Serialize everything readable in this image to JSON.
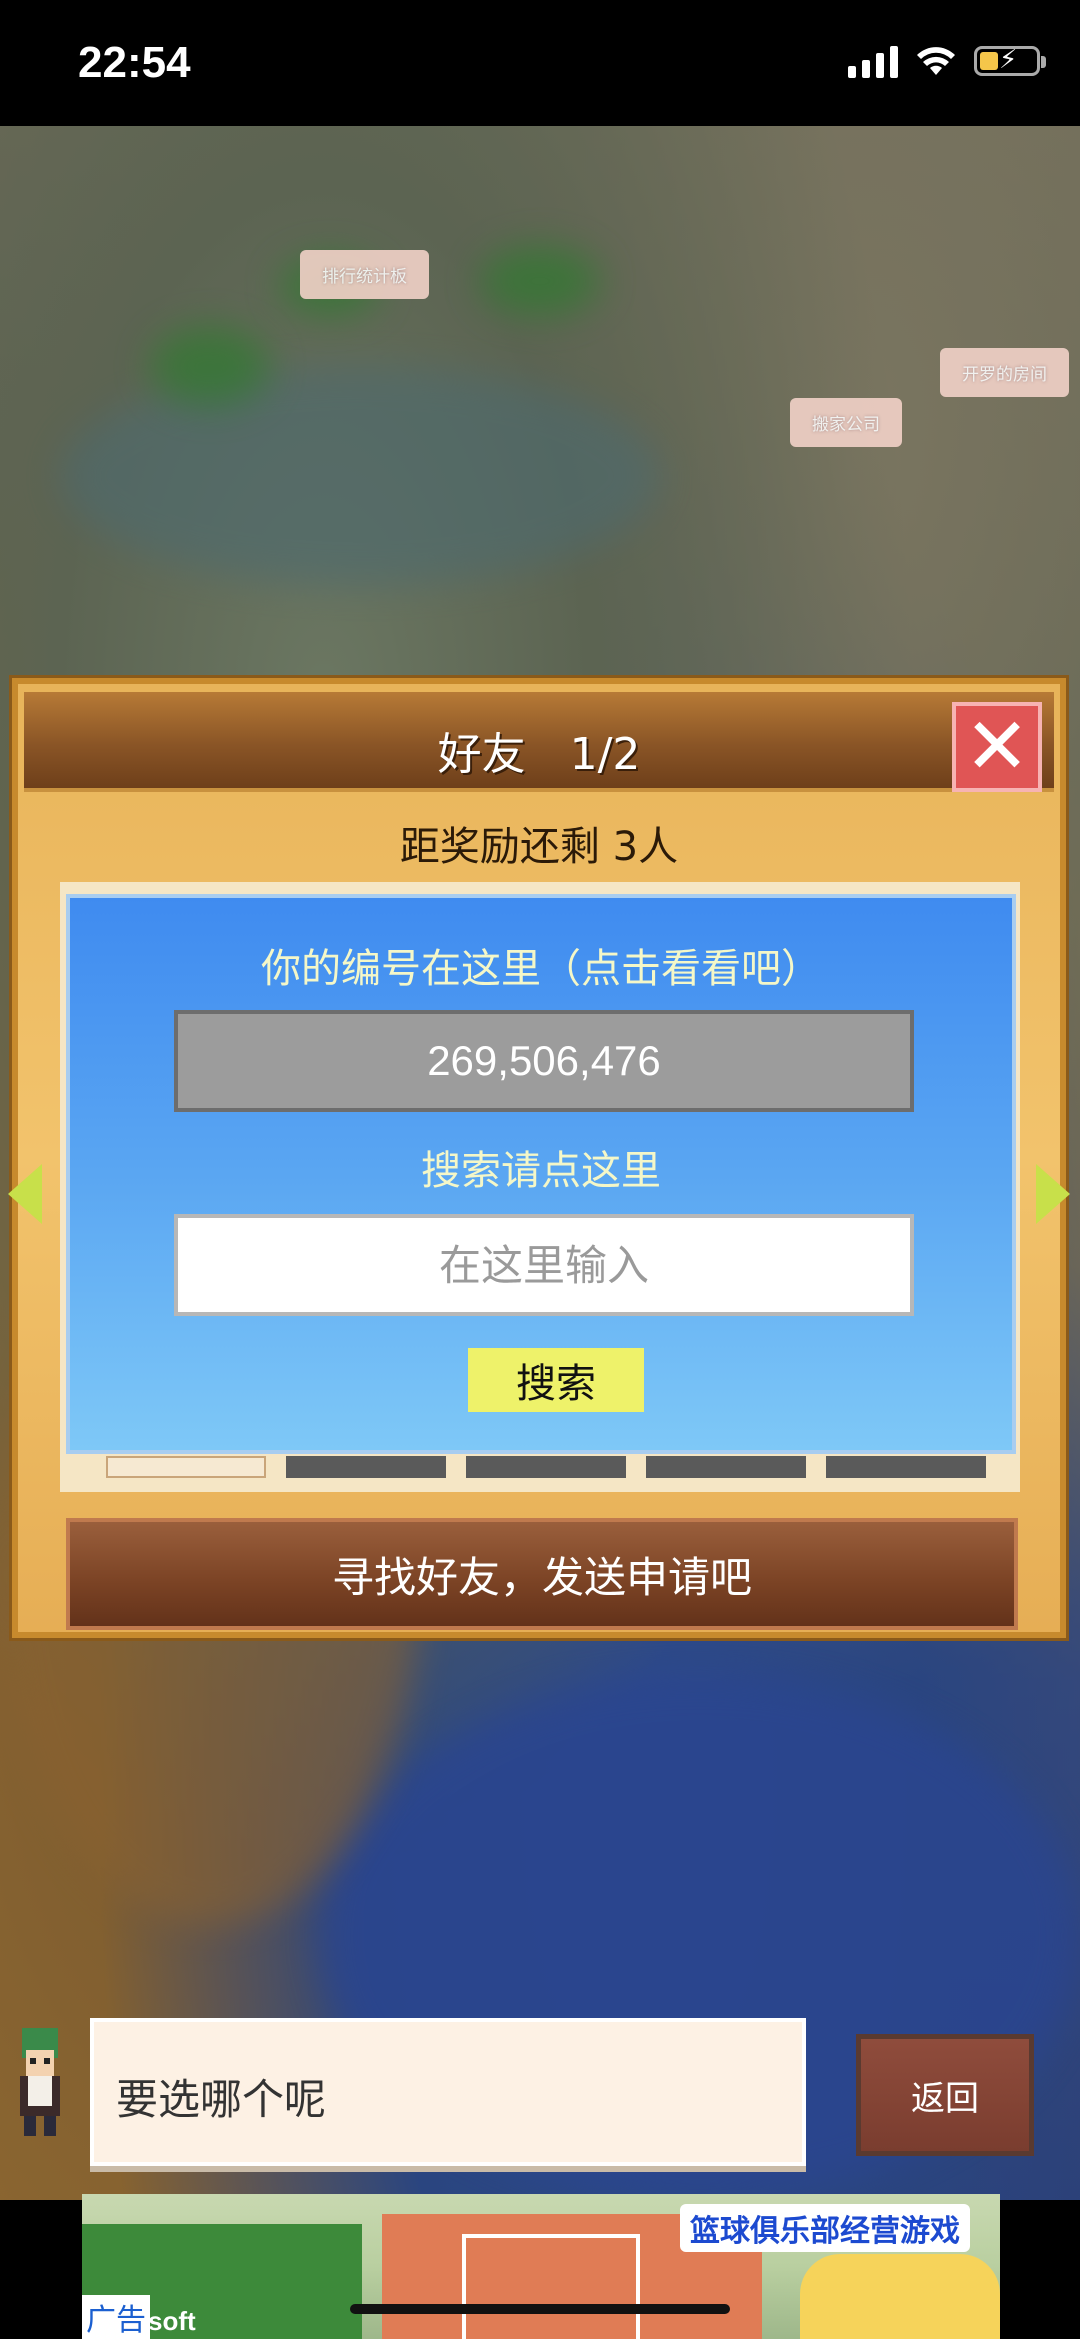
{
  "status_bar": {
    "time": "22:54"
  },
  "map_labels": [
    "排行统计板",
    "开罗的房间",
    "搬家公司"
  ],
  "dialog": {
    "title": "好友　1/2",
    "reward_text": "距奖励还剩 3人",
    "id_label": "你的编号在这里（点击看看吧）",
    "id_value": "269,506,476",
    "search_label": "搜索请点这里",
    "search_placeholder": "在这里输入",
    "search_button": "搜索",
    "find_friends_button": "寻找好友，发送申请吧"
  },
  "bottom": {
    "message": "要选哪个呢",
    "back_button": "返回"
  },
  "ad": {
    "title": "篮球俱乐部经营游戏",
    "tag": "广告",
    "brand": "soft"
  },
  "colors": {
    "panel_blue": "#3f8bf0",
    "close_red": "#e05555",
    "search_button_yellow": "#eef26a",
    "header_brown": "#8a5526"
  }
}
